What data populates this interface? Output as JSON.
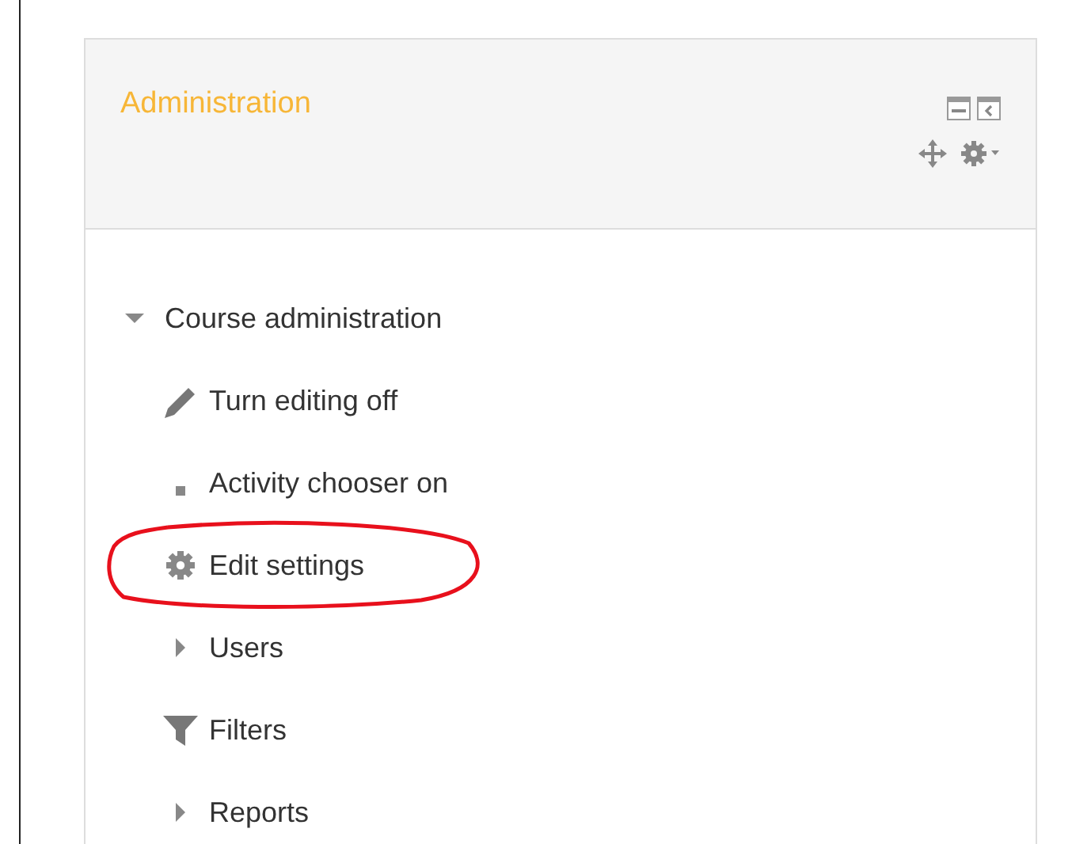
{
  "block": {
    "title": "Administration"
  },
  "tree": [
    {
      "label": "Course administration",
      "kind": "node",
      "expanded": true,
      "children": [
        {
          "label": "Turn editing off",
          "kind": "pencil",
          "circled": false
        },
        {
          "label": "Activity chooser on",
          "kind": "bullet",
          "circled": false
        },
        {
          "label": "Edit settings",
          "kind": "gear",
          "circled": true
        },
        {
          "label": "Users",
          "kind": "node",
          "expanded": false,
          "circled": false
        },
        {
          "label": "Filters",
          "kind": "filter",
          "circled": false
        },
        {
          "label": "Reports",
          "kind": "node",
          "expanded": false,
          "circled": false
        }
      ]
    }
  ]
}
